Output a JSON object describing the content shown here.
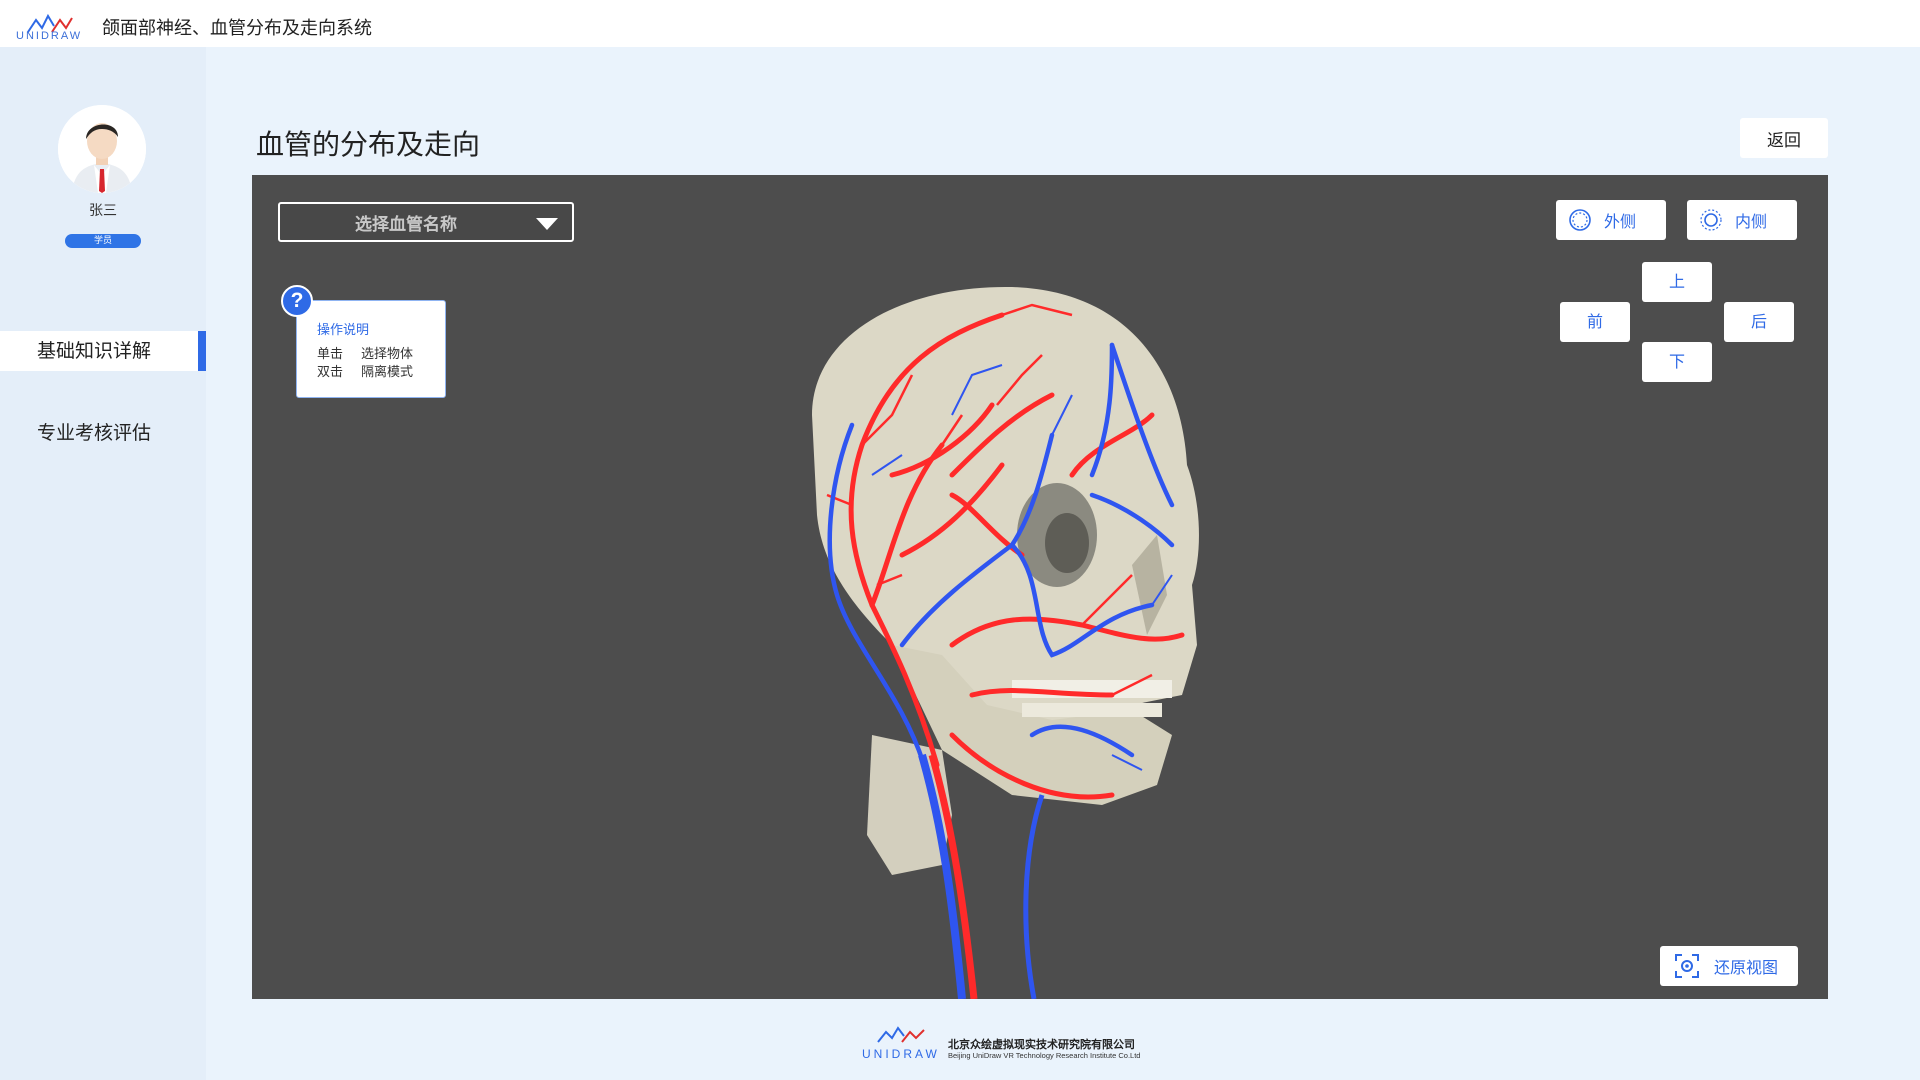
{
  "app": {
    "logo_text": "UNIDRAW",
    "title": "颌面部神经、血管分布及走向系统"
  },
  "user": {
    "name": "张三",
    "role": "学员"
  },
  "sidebar": {
    "items": [
      {
        "label": "基础知识详解",
        "active": true
      },
      {
        "label": "专业考核评估",
        "active": false
      }
    ]
  },
  "page": {
    "title": "血管的分布及走向",
    "back_label": "返回"
  },
  "viewer": {
    "select_placeholder": "选择血管名称",
    "help": {
      "icon": "?",
      "title": "操作说明",
      "rows": [
        {
          "action": "单击",
          "effect": "选择物体"
        },
        {
          "action": "双击",
          "effect": "隔离模式"
        }
      ]
    },
    "view_buttons": {
      "outer": "外侧",
      "inner": "内侧",
      "up": "上",
      "front": "前",
      "back": "后",
      "down": "下"
    },
    "restore_label": "还原视图"
  },
  "footer": {
    "company_cn": "北京众绘虚拟现实技术研究院有限公司",
    "company_en": "Beijing UniDraw VR Technology Research Institute Co.Ltd",
    "logo_text": "UNIDRAW"
  },
  "colors": {
    "accent": "#2f6ae6",
    "artery": "#ff2a2a",
    "vein": "#2f55f0",
    "viewer_bg": "#4d4d4d"
  }
}
